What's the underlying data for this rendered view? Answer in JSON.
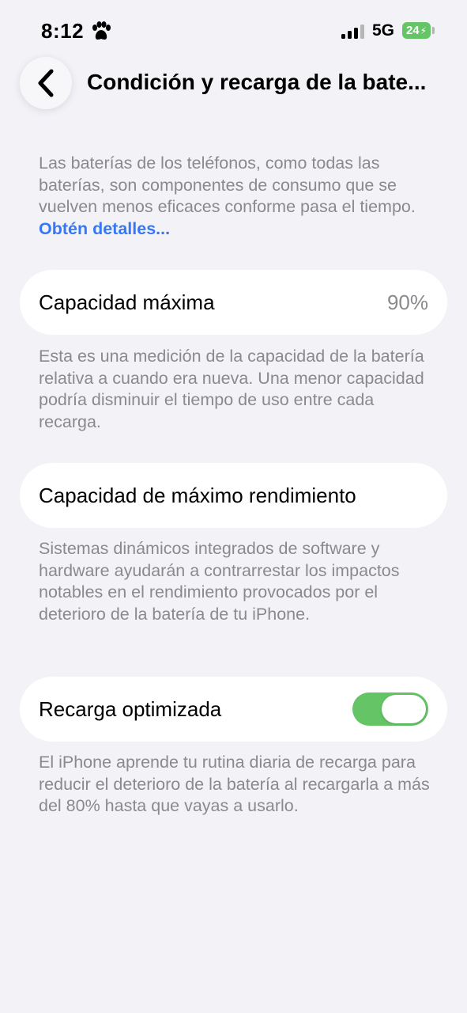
{
  "status_bar": {
    "time": "8:12",
    "time_icon": "paw-icon",
    "signal_icon": "signal-bars-icon",
    "network": "5G",
    "battery_level": "24",
    "battery_color": "#65c466"
  },
  "nav": {
    "back_icon": "chevron-left-icon",
    "title": "Condición y recarga de la bate..."
  },
  "intro": {
    "text": "Las baterías de los teléfonos, como todas las baterías, son componentes de consumo que se vuelven menos eficaces conforme pasa el tiempo.",
    "link": "Obtén detalles..."
  },
  "maximum_capacity": {
    "label": "Capacidad máxima",
    "value": "90%",
    "footer": "Esta es una medición de la capacidad de la batería relativa a cuando era nueva. Una menor capacidad podría disminuir el tiempo de uso entre cada recarga."
  },
  "peak_performance": {
    "label": "Capacidad de máximo rendimiento",
    "footer": "Sistemas dinámicos integrados de software y hardware ayudarán a contrarrestar los impactos notables en el rendimiento provocados por el deterioro de la batería de tu iPhone."
  },
  "optimized_charging": {
    "label": "Recarga optimizada",
    "enabled": true,
    "toggle_color": "#65c466",
    "footer": "El iPhone aprende tu rutina diaria de recarga para reducir el deterioro de la batería al recargarla a más del 80% hasta que vayas a usarlo."
  },
  "colors": {
    "background": "#f2f2f7",
    "accent": "#3478f6",
    "secondary_text": "#8a8a8e"
  }
}
